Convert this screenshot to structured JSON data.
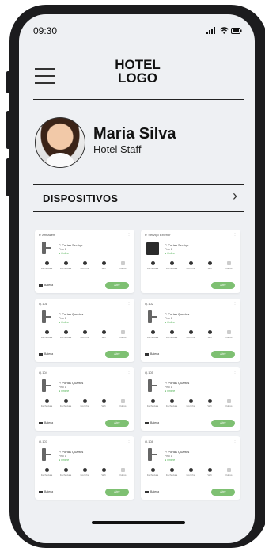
{
  "status": {
    "time": "09:30"
  },
  "header": {
    "logo_line1": "HOTEL",
    "logo_line2": "LOGO"
  },
  "profile": {
    "name": "Maria Silva",
    "role": "Hotel Staff"
  },
  "section": {
    "title": "DISPOSITIVOS"
  },
  "devices": [
    {
      "title": "P. Armazém",
      "name": "P. Portas Serviço",
      "floor": "Piso 1",
      "status": "Online",
      "type": "lock",
      "actions": [
        "Fechadura",
        "Fechadura",
        "Cozinha",
        "Wifi",
        "Outros"
      ],
      "battery": "Bateria",
      "open": "Abrir"
    },
    {
      "title": "P. Serviço Exterior",
      "name": "P. Portas Serviço",
      "floor": "Piso 1",
      "status": "Online",
      "type": "box",
      "actions": [
        "Fechadura",
        "Fechadura",
        "Cozinha",
        "Wifi",
        "Outros"
      ],
      "battery": "",
      "open": "Abrir"
    },
    {
      "title": "Q.101",
      "name": "P. Portas Quartos",
      "floor": "Piso 1",
      "status": "Online",
      "type": "lock",
      "actions": [
        "Fechadura",
        "Fechadura",
        "Cozinha",
        "Wifi",
        "Outros"
      ],
      "battery": "Bateria",
      "open": "Abrir"
    },
    {
      "title": "Q.102",
      "name": "P. Portas Quartos",
      "floor": "Piso 1",
      "status": "Online",
      "type": "lock",
      "actions": [
        "Fechadura",
        "Fechadura",
        "Cozinha",
        "Wifi",
        "Outros"
      ],
      "battery": "Bateria",
      "open": "Abrir"
    },
    {
      "title": "Q.104",
      "name": "P. Portas Quartos",
      "floor": "Piso 1",
      "status": "Online",
      "type": "lock",
      "actions": [
        "Fechadura",
        "Fechadura",
        "Cozinha",
        "Wifi",
        "Outros"
      ],
      "battery": "Bateria",
      "open": "Abrir"
    },
    {
      "title": "Q.105",
      "name": "P. Portas Quartos",
      "floor": "Piso 1",
      "status": "Online",
      "type": "lock",
      "actions": [
        "Fechadura",
        "Fechadura",
        "Cozinha",
        "Wifi",
        "Outros"
      ],
      "battery": "Bateria",
      "open": "Abrir"
    },
    {
      "title": "Q.107",
      "name": "P. Portas Quartos",
      "floor": "Piso 1",
      "status": "Online",
      "type": "lock",
      "actions": [
        "Fechadura",
        "Fechadura",
        "Cozinha",
        "Wifi",
        "Outros"
      ],
      "battery": "Bateria",
      "open": "Abrir"
    },
    {
      "title": "Q.108",
      "name": "P. Portas Quartos",
      "floor": "Piso 1",
      "status": "Online",
      "type": "lock",
      "actions": [
        "Fechadura",
        "Fechadura",
        "Cozinha",
        "Wifi",
        "Outros"
      ],
      "battery": "Bateria",
      "open": "Abrir"
    }
  ],
  "colors": {
    "accent": "#7ec072",
    "background": "#eef0f3"
  },
  "icons": {
    "menu": "hamburger-icon",
    "chevron": "chevron-right-icon",
    "signal": "signal-icon",
    "wifi": "wifi-icon",
    "battery": "battery-icon"
  }
}
